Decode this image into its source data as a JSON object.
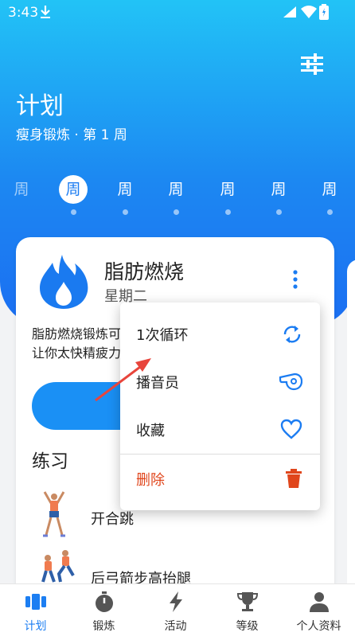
{
  "status_bar": {
    "time": "3:43"
  },
  "header": {
    "title": "计划",
    "subtitle": "瘦身锻炼 · 第 1 周"
  },
  "weeks": [
    {
      "label": "周",
      "active": false
    },
    {
      "label": "周",
      "active": true
    },
    {
      "label": "周",
      "active": false
    },
    {
      "label": "周",
      "active": false
    },
    {
      "label": "周",
      "active": false
    },
    {
      "label": "周",
      "active": false
    },
    {
      "label": "周",
      "active": false
    }
  ],
  "workout": {
    "title": "脂肪燃烧",
    "day": "星期二",
    "description_line1": "脂肪燃烧锻炼可",
    "description_line2": "让你太快精疲力"
  },
  "exercises_section": {
    "title": "练习"
  },
  "exercises": [
    {
      "name": "开合跳",
      "icon": "jumping-jack-figure"
    },
    {
      "name": "后弓箭步高抬腿",
      "icon": "lunge-figure"
    }
  ],
  "context_menu": {
    "items": [
      {
        "label": "1次循环",
        "icon": "repeat-icon"
      },
      {
        "label": "播音员",
        "icon": "whistle-icon"
      },
      {
        "label": "收藏",
        "icon": "heart-icon"
      },
      {
        "label": "删除",
        "icon": "trash-icon"
      }
    ]
  },
  "bottom_nav": [
    {
      "label": "计划",
      "icon": "plan-icon",
      "active": true
    },
    {
      "label": "锻炼",
      "icon": "stopwatch-icon",
      "active": false
    },
    {
      "label": "活动",
      "icon": "lightning-icon",
      "active": false
    },
    {
      "label": "等级",
      "icon": "trophy-icon",
      "active": false
    },
    {
      "label": "个人资料",
      "icon": "person-icon",
      "active": false
    }
  ],
  "colors": {
    "primary": "#1b7cf2",
    "header_top": "#22c3f6",
    "delete": "#e0461c",
    "flame": "#1a7af0"
  }
}
